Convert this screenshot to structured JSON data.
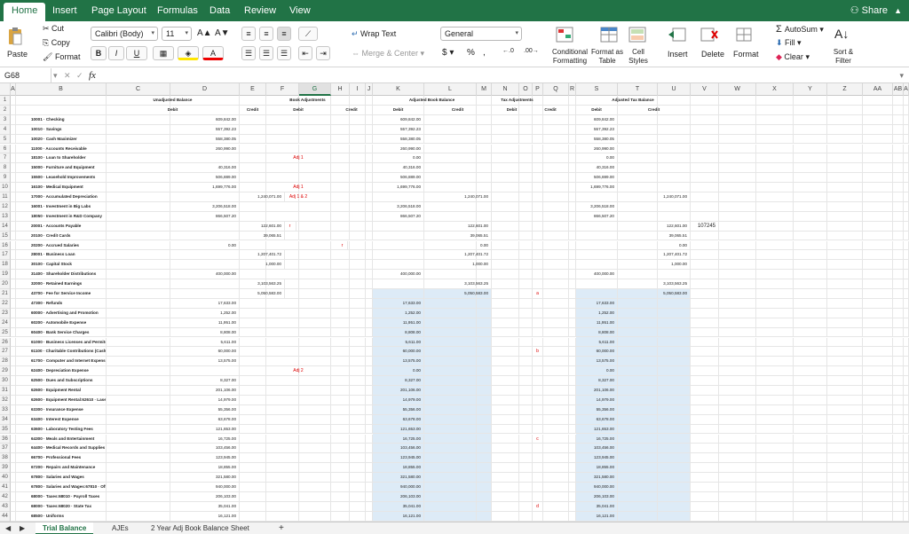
{
  "menu": {
    "tabs": [
      "Home",
      "Insert",
      "Page Layout",
      "Formulas",
      "Data",
      "Review",
      "View"
    ],
    "share_label": "Share",
    "collapse_icon": "chevron-up-icon"
  },
  "ribbon": {
    "paste_label": "Paste",
    "cut_label": "Cut",
    "copy_label": "Copy",
    "format_label": "Format",
    "font_name": "Calibri (Body)",
    "font_size": "11",
    "bold": "B",
    "italic": "I",
    "underline": "U",
    "wrap_text": "Wrap Text",
    "merge_center": "Merge & Center",
    "number_format": "General",
    "currency": "$",
    "percent": "%",
    "comma": ",",
    "conditional_formatting": "Conditional Formatting",
    "format_as_table": "Format as Table",
    "cell_styles": "Cell Styles",
    "insert": "Insert",
    "delete": "Delete",
    "format": "Format",
    "autosum": "AutoSum",
    "fill": "Fill",
    "clear": "Clear",
    "sort_filter": "Sort & Filter",
    "accent": "#217346"
  },
  "formula_bar": {
    "name_box": "G68",
    "fx": "fx",
    "formula": ""
  },
  "columns": [
    "A",
    "B",
    "C",
    "D",
    "E",
    "F",
    "G",
    "H",
    "I",
    "J",
    "K",
    "L",
    "M",
    "N",
    "O",
    "P",
    "Q",
    "R",
    "S",
    "T",
    "U",
    "V",
    "W",
    "X",
    "Y",
    "Z",
    "AA",
    "AB",
    "A"
  ],
  "selected_column": "G",
  "sheet": {
    "section_headers": {
      "unadjusted": "Unadjusted Balance",
      "book_adj": "Book Adjustments",
      "adjusted_book": "Adjusted Book Balance",
      "tax_adj": "Tax Adjustments",
      "adjusted_tax": "Adjusted Tax Balance"
    },
    "debit": "Debit",
    "credit": "Credit",
    "loose_value": "107245",
    "rows": [
      {
        "n": "1"
      },
      {
        "n": "2"
      },
      {
        "n": "3",
        "acct": "10001 · Checking",
        "ud": "609,842.00",
        "akd": "609,842.00",
        "atd": "609,842.00"
      },
      {
        "n": "4",
        "acct": "10010 · Savings",
        "ud": "557,392.23",
        "akd": "557,392.23",
        "atd": "557,392.23"
      },
      {
        "n": "5",
        "acct": "10020 · Cash Maximizer",
        "ud": "558,380.05",
        "akd": "558,380.05",
        "atd": "558,380.05"
      },
      {
        "n": "6",
        "acct": "11000 · Accounts Receivable",
        "ud": "260,990.00",
        "akd": "260,990.00",
        "atd": "260,990.00"
      },
      {
        "n": "7",
        "acct": "18100 · Loan to Shareholder",
        "adj": "Adj 1",
        "akd": "0.00",
        "atd": "0.00"
      },
      {
        "n": "8",
        "acct": "15000 · Furniture and Equipment",
        "ud": "40,316.00",
        "akd": "40,316.00",
        "atd": "40,316.00"
      },
      {
        "n": "9",
        "acct": "15500 · Leasehold Improvements",
        "ud": "506,889.00",
        "akd": "506,889.00",
        "atd": "506,889.00"
      },
      {
        "n": "10",
        "acct": "16100 · Medical Equipment",
        "ud": "1,699,776.00",
        "adj": "Adj 1",
        "akd": "1,699,776.00",
        "atd": "1,699,776.00"
      },
      {
        "n": "11",
        "acct": "17000 · Accumulated Depreciation",
        "uc": "1,240,071.00",
        "adj": "Adj 1 & 2",
        "akc": "1,240,071.00",
        "atc": "1,240,071.00"
      },
      {
        "n": "12",
        "acct": "16001 · Investment in Big Labs",
        "ud": "3,206,518.00",
        "akd": "3,206,518.00",
        "atd": "3,206,518.00"
      },
      {
        "n": "13",
        "acct": "18050 · Investment in R&D Company",
        "ud": "866,507.20",
        "akd": "866,507.20",
        "atd": "866,507.20"
      },
      {
        "n": "14",
        "acct": "20001 · Accounts Payable",
        "uc": "122,601.00",
        "mark": "r",
        "akc": "122,601.00",
        "atc": "122,601.00",
        "extra": "107245"
      },
      {
        "n": "15",
        "acct": "20100 · Credit Cards",
        "uc": "39,065.51",
        "akc": "39,065.51",
        "atc": "39,065.51"
      },
      {
        "n": "16",
        "acct": "20200 · Accrued Salaries",
        "ud": "0.00",
        "mark2": "r",
        "akc": "0.00",
        "atc": "0.00"
      },
      {
        "n": "17",
        "acct": "28001 · Business Loan",
        "uc": "1,207,401.72",
        "akc": "1,207,401.72",
        "atc": "1,207,401.72"
      },
      {
        "n": "18",
        "acct": "30100 · Capital Stock",
        "uc": "1,000.00",
        "akc": "1,000.00",
        "atc": "1,000.00"
      },
      {
        "n": "19",
        "acct": "31400 · Shareholder Distributions",
        "ud": "400,000.00",
        "akd": "400,000.00",
        "atd": "400,000.00"
      },
      {
        "n": "20",
        "acct": "32000 · Retained Earnings",
        "uc": "3,103,563.25",
        "akc": "3,103,563.25",
        "atc": "3,103,563.25"
      },
      {
        "n": "21",
        "acct": "43700 · Fee for Service Income",
        "uc": "5,050,583.00",
        "akc": "5,050,583.00",
        "atc": "5,050,583.00",
        "tmark": "a"
      },
      {
        "n": "22",
        "acct": "47300 · Refunds",
        "ud": "17,633.00",
        "akd": "17,633.00",
        "atd": "17,633.00"
      },
      {
        "n": "23",
        "acct": "60000 · Advertising and Promotion",
        "ud": "1,252.00",
        "akd": "1,252.00",
        "atd": "1,252.00"
      },
      {
        "n": "24",
        "acct": "60200 · Automobile Expense",
        "ud": "11,951.00",
        "akd": "11,951.00",
        "atd": "11,951.00"
      },
      {
        "n": "25",
        "acct": "60400 · Bank Service Charges",
        "ud": "8,808.00",
        "akd": "8,808.00",
        "atd": "8,808.00"
      },
      {
        "n": "26",
        "acct": "61000 · Business Licenses and Permits",
        "ud": "5,611.00",
        "akd": "5,611.00",
        "atd": "5,611.00"
      },
      {
        "n": "27",
        "acct": "61100 · Charitable Contributions (Cash)",
        "ud": "60,000.00",
        "akd": "60,000.00",
        "atd": "60,000.00",
        "tmark": "b"
      },
      {
        "n": "28",
        "acct": "61700 · Computer and Internet Expenses",
        "ud": "13,575.00",
        "akd": "13,575.00",
        "atd": "13,575.00"
      },
      {
        "n": "29",
        "acct": "62400 · Depreciation Expense",
        "adj": "Adj 2",
        "akd": "0.00",
        "atd": "0.00"
      },
      {
        "n": "30",
        "acct": "62500 · Dues and Subscriptions",
        "ud": "8,327.00",
        "akd": "8,327.00",
        "atd": "8,327.00"
      },
      {
        "n": "31",
        "acct": "62600 · Equipment Rental",
        "ud": "201,106.00",
        "akd": "201,106.00",
        "atd": "201,106.00"
      },
      {
        "n": "32",
        "acct": "62600 · Equipment Rental:62610 · Laser Facility Rent",
        "ud": "14,979.00",
        "akd": "14,979.00",
        "atd": "14,979.00"
      },
      {
        "n": "33",
        "acct": "63300 · Insurance Expense",
        "ud": "55,356.00",
        "akd": "55,356.00",
        "atd": "55,356.00"
      },
      {
        "n": "34",
        "acct": "63400 · Interest Expense",
        "ud": "63,678.00",
        "akd": "63,678.00",
        "atd": "63,678.00"
      },
      {
        "n": "35",
        "acct": "63600 · Laboratory Testing Fees",
        "ud": "121,653.00",
        "akd": "121,653.00",
        "atd": "121,653.00"
      },
      {
        "n": "36",
        "acct": "64300 · Meals and Entertainment",
        "ud": "16,725.00",
        "akd": "16,725.00",
        "atd": "16,725.00",
        "tmark": "c"
      },
      {
        "n": "37",
        "acct": "64400 · Medical Records and Supplies",
        "ud": "103,456.00",
        "akd": "103,456.00",
        "atd": "103,456.00"
      },
      {
        "n": "38",
        "acct": "66700 · Professional Fees",
        "ud": "123,945.00",
        "akd": "123,945.00",
        "atd": "123,945.00"
      },
      {
        "n": "39",
        "acct": "67200 · Repairs and Maintenance",
        "ud": "18,855.00",
        "akd": "18,855.00",
        "atd": "18,855.00"
      },
      {
        "n": "40",
        "acct": "67800 · Salaries and Wages",
        "ud": "321,580.00",
        "akd": "321,580.00",
        "atd": "321,580.00"
      },
      {
        "n": "41",
        "acct": "67800 · Salaries and Wages:67810 · Officer Compensation",
        "ud": "940,000.00",
        "akd": "940,000.00",
        "atd": "940,000.00"
      },
      {
        "n": "42",
        "acct": "68000 · Taxes:68010 · Payroll Taxes",
        "ud": "206,103.00",
        "akd": "206,103.00",
        "atd": "206,103.00"
      },
      {
        "n": "43",
        "acct": "68000 · Taxes:68020 · State Tax",
        "ud": "35,041.00",
        "akd": "35,041.00",
        "atd": "35,041.00",
        "tmark": "d"
      },
      {
        "n": "44",
        "acct": "68500 · Uniforms",
        "ud": "16,121.00",
        "akd": "16,121.00",
        "atd": "16,121.00"
      }
    ]
  },
  "sheet_tabs": [
    "Trial Balance",
    "AJEs",
    "2 Year Adj Book Balance Sheet"
  ],
  "active_sheet": "Trial Balance",
  "add_sheet": "+"
}
